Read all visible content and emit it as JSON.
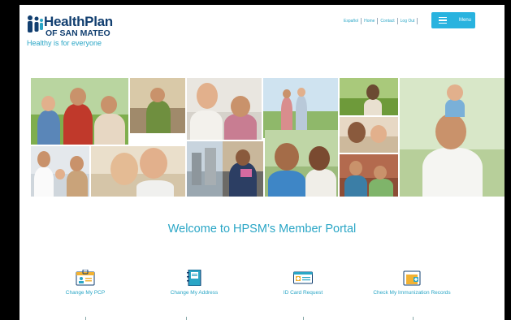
{
  "header": {
    "logo": {
      "name_line1": "HealthPlan",
      "name_line2": "OF SAN MATEO",
      "tagline": "Healthy is for everyone"
    },
    "links": [
      "Español",
      "Home",
      "Contact",
      "Log Out"
    ],
    "menu_label": "Menu"
  },
  "main": {
    "welcome": "Welcome to HPSM’s Member Portal",
    "actions": [
      {
        "label": "Change My PCP",
        "icon": "id-badge-icon"
      },
      {
        "label": "Change My Address",
        "icon": "address-book-icon"
      },
      {
        "label": "ID Card Request",
        "icon": "id-card-icon"
      },
      {
        "label": "Check My Immunization Records",
        "icon": "medical-folder-icon"
      }
    ]
  },
  "colors": {
    "brand_navy": "#123f70",
    "accent_teal": "#2aa6c6",
    "menu_blue": "#29b3df"
  }
}
